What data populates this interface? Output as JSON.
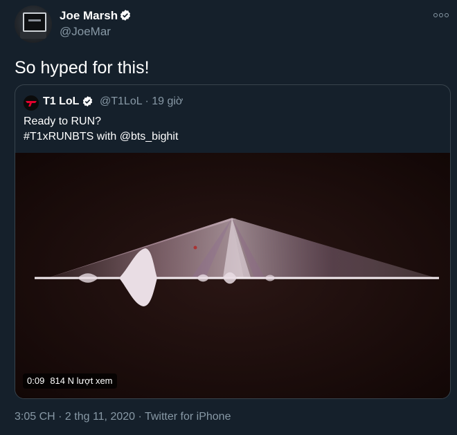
{
  "author": {
    "display_name": "Joe Marsh",
    "handle": "@JoeMar",
    "verified": true,
    "avatar_icon": "tv-avatar"
  },
  "tweet": {
    "text": "So hyped for this!"
  },
  "more_icon": "ellipsis-icon",
  "quoted_tweet": {
    "author_name": "T1 LoL",
    "verified": true,
    "handle_time": "@T1LoL · 19 giờ",
    "line1": "Ready to RUN?",
    "line2": "#T1xRUNBTS with @bts_bighit",
    "video": {
      "duration": "0:09",
      "views": "814 N lượt xem"
    }
  },
  "meta": {
    "text": "3:05 CH · 2 thg 11, 2020 · Twitter for iPhone"
  },
  "colors": {
    "background": "#15202b",
    "secondary_text": "#8899a6",
    "border": "#38444d",
    "verified": "#ffffff"
  }
}
